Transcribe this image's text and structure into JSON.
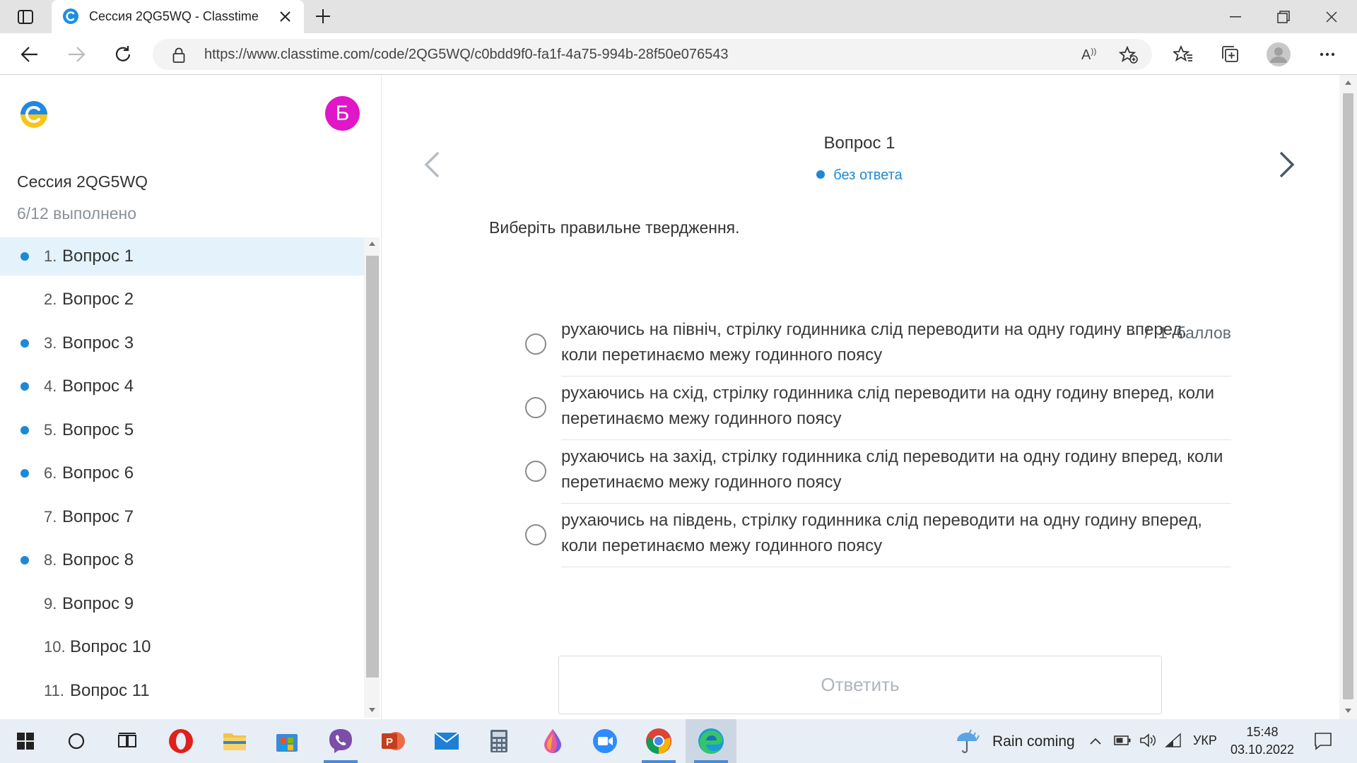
{
  "browser": {
    "tab_title": "Сессия 2QG5WQ - Classtime",
    "url": "https://www.classtime.com/code/2QG5WQ/c0bdd9f0-fa1f-4a75-994b-28f50e076543"
  },
  "sidebar": {
    "avatar_letter": "Б",
    "session_title": "Сессия 2QG5WQ",
    "progress": "6/12 выполнено",
    "items": [
      {
        "num": "1.",
        "label": "Вопрос 1",
        "answered": true,
        "selected": true
      },
      {
        "num": "2.",
        "label": "Вопрос 2",
        "answered": false
      },
      {
        "num": "3.",
        "label": "Вопрос 3",
        "answered": true
      },
      {
        "num": "4.",
        "label": "Вопрос 4",
        "answered": true
      },
      {
        "num": "5.",
        "label": "Вопрос 5",
        "answered": true
      },
      {
        "num": "6.",
        "label": "Вопрос 6",
        "answered": true
      },
      {
        "num": "7.",
        "label": "Вопрос 7",
        "answered": false
      },
      {
        "num": "8.",
        "label": "Вопрос 8",
        "answered": true
      },
      {
        "num": "9.",
        "label": "Вопрос 9",
        "answered": false
      },
      {
        "num": "10.",
        "label": "Вопрос 10",
        "answered": false
      },
      {
        "num": "11.",
        "label": "Вопрос 11",
        "answered": false
      }
    ]
  },
  "question": {
    "title": "Вопрос 1",
    "status": "без ответа",
    "prompt": "Виберіть правильне твердження.",
    "score_dash": "-",
    "score_slash": "/",
    "score_max": "1",
    "score_unit": "баллов",
    "options": [
      "рухаючись на північ, стрілку годинника слід переводити на одну годину вперед, коли перетинаємо межу годинного поясу",
      "рухаючись на схід, стрілку годинника слід переводити на одну годину вперед, коли перетинаємо межу годинного поясу",
      "рухаючись на захід, стрілку годинника слід переводити на одну годину вперед, коли перетинаємо межу годинного поясу",
      "рухаючись на південь, стрілку годинника слід переводити на одну годину вперед, коли перетинаємо межу годинного поясу"
    ],
    "submit_label": "Ответить"
  },
  "taskbar": {
    "weather": "Rain coming",
    "language": "УКР",
    "time": "15:48",
    "date": "03.10.2022"
  },
  "colors": {
    "accent": "#1e88d6",
    "selected_bg": "#e3f2fb",
    "avatar": "#e016c8"
  }
}
